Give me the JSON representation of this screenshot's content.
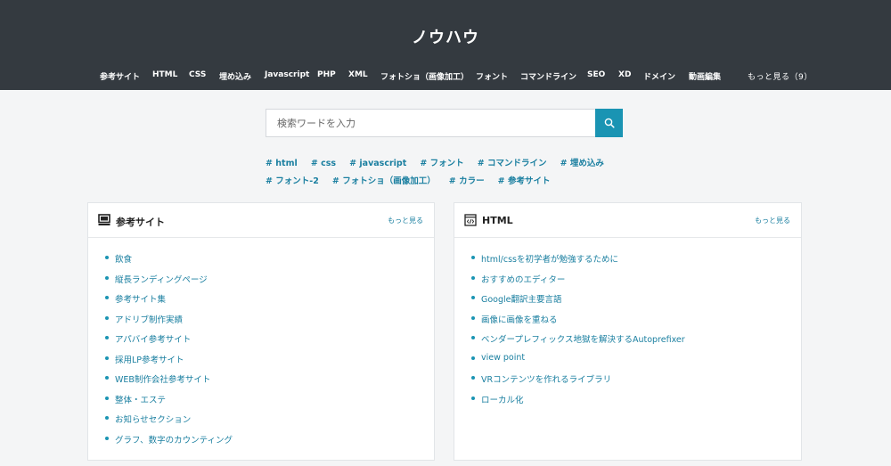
{
  "header": {
    "title": "ノウハウ",
    "nav": [
      "参考サイト",
      "HTML",
      "CSS",
      "埋め込み",
      "Javascript",
      "PHP",
      "XML",
      "フォトショ（画像加工）",
      "フォント",
      "コマンドライン",
      "SEO",
      "XD",
      "ドメイン",
      "動画編集"
    ],
    "more_label": "もっと見る（9）"
  },
  "search": {
    "placeholder": "検索ワードを入力",
    "button_icon": "search-icon"
  },
  "tags": {
    "row1": [
      "# html",
      "# css",
      "# javascript",
      "# フォント",
      "# コマンドライン",
      "# 埋め込み"
    ],
    "row2": [
      "# フォント-2",
      "# フォトショ（画像加工）",
      "# カラー",
      "# 参考サイト"
    ]
  },
  "cards": [
    {
      "title": "参考サイト",
      "icon": "monitor-icon",
      "more_label": "もっと見る",
      "items": [
        "飲食",
        "縦長ランディングページ",
        "参考サイト集",
        "アドリブ制作実績",
        "アパバイ参考サイト",
        "採用LP参考サイト",
        "WEB制作会社参考サイト",
        "整体・エステ",
        "お知らせセクション",
        "グラフ、数字のカウンティング"
      ]
    },
    {
      "title": "HTML",
      "icon": "code-window-icon",
      "more_label": "もっと見る",
      "items": [
        "html/cssを初学者が勉強するために",
        "おすすめのエディター",
        "Google翻訳主要言語",
        "画像に画像を重ねる",
        "ベンダープレフィックス地獄を解決するAutoprefixer",
        "view point",
        "VRコンテンツを作れるライブラリ",
        "ローカル化"
      ]
    }
  ],
  "colors": {
    "header_bg": "#343a40",
    "accent": "#1a94b3",
    "link": "#1a7fa0"
  }
}
